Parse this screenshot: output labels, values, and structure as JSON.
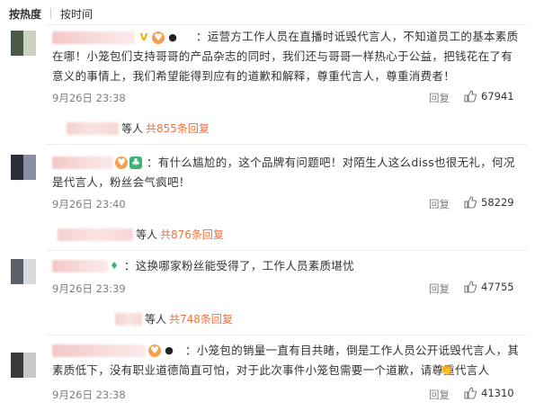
{
  "sort": {
    "hot": "按热度",
    "time": "按时间"
  },
  "comments": [
    {
      "text": "：运营方工作人员在直播时诋毁代言人，不知道员工的基本素质在哪！小笼包们支持哥哥的产品杂志的同时，我们还与哥哥一样热心于公益，把钱花在了有意义的事情上，我们希望能得到应有的道歉和解释，尊重代言人，尊重消费者！",
      "date": "9月26日 23:38",
      "reply": "回复",
      "likes": "67941",
      "sub_prefix": "等人",
      "sub_link": "共855条回复"
    },
    {
      "text": "：有什么尴尬的，这个品牌有问题吧！对陌生人这么diss也很无礼，何况是代言人，粉丝会气疯吧！",
      "date": "9月26日 23:40",
      "reply": "回复",
      "likes": "58229",
      "sub_prefix": "等人",
      "sub_link": "共876条回复"
    },
    {
      "text": "：这换哪家粉丝能受得了，工作人员素质堪忧",
      "date": "9月26日 23:39",
      "reply": "回复",
      "likes": "47755",
      "sub_prefix": "等人",
      "sub_link": "共748条回复"
    },
    {
      "text": "：小笼包的销量一直有目共睹，倒是工作人员公开诋毁代言人，其素质低下，没有职业道德简直可怕，对于此次事件小笼包需要一个道歉，请尊重代言人",
      "date": "9月26日 23:38",
      "reply": "回复",
      "likes": "41310"
    }
  ],
  "colors": {
    "link": "#eb7340",
    "meta": "#808080",
    "divider": "#eeeeee"
  },
  "icons": {
    "like": "thumbs-up-icon",
    "vip": "v-badge-icon",
    "fan": "fan-badge-icon",
    "panda": "panda-icon",
    "clap": "clapping-hands-icon"
  }
}
